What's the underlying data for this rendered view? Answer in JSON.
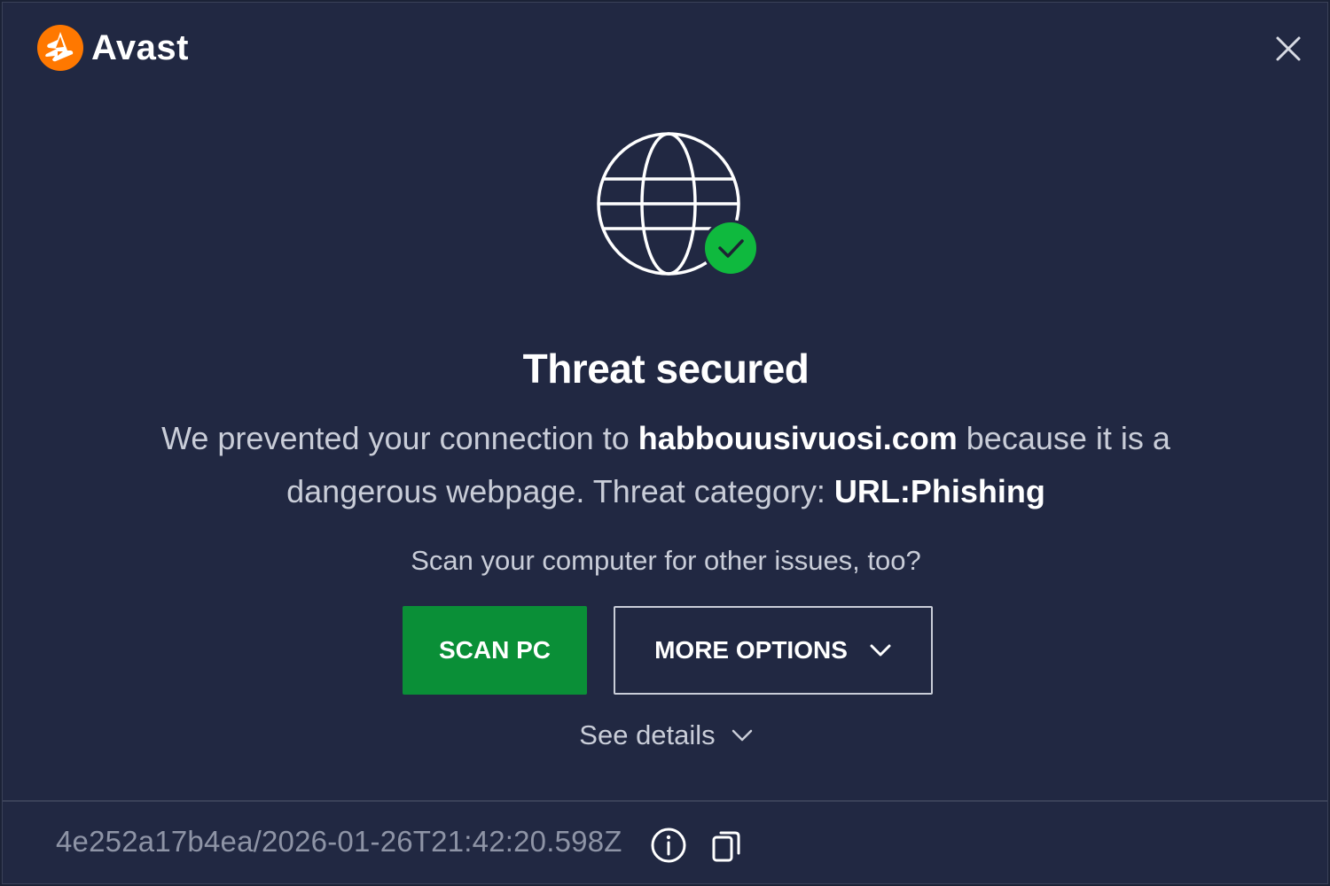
{
  "app": {
    "name": "Avast",
    "brand_color": "#ff7800",
    "background_color": "#212842"
  },
  "header": {
    "close_icon": "close-icon"
  },
  "hero": {
    "icon": "globe-icon",
    "badge_icon": "checkmark-icon",
    "badge_color": "#0fb93e"
  },
  "alert": {
    "title": "Threat secured",
    "message_part1": "We prevented your connection to ",
    "domain": "habbouusivuosi.com",
    "message_part2": " because it is a dangerous webpage. Threat category: ",
    "category": "URL:Phishing"
  },
  "prompt": {
    "question": "Scan your computer for other issues, too?"
  },
  "actions": {
    "scan_label": "SCAN PC",
    "scan_color": "#0a8f37",
    "more_label": "MORE OPTIONS",
    "see_details_label": "See details"
  },
  "footer": {
    "event_id": "4e252a17b4ea/2026-01-26T21:42:20.598Z",
    "info_icon": "info-icon",
    "copy_icon": "copy-icon"
  }
}
